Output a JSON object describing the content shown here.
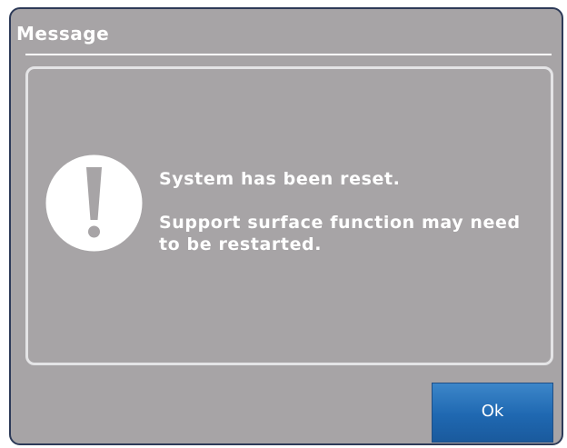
{
  "dialog": {
    "title": "Message",
    "icon": "exclamation-alert-icon",
    "message_line1": "System has been reset.",
    "message_line2": "Support surface function may need to be restarted.",
    "ok_label": "Ok"
  },
  "colors": {
    "background": "#a7a4a6",
    "border": "#2d3a58",
    "text": "#ffffff",
    "button": "#1f68b1"
  }
}
